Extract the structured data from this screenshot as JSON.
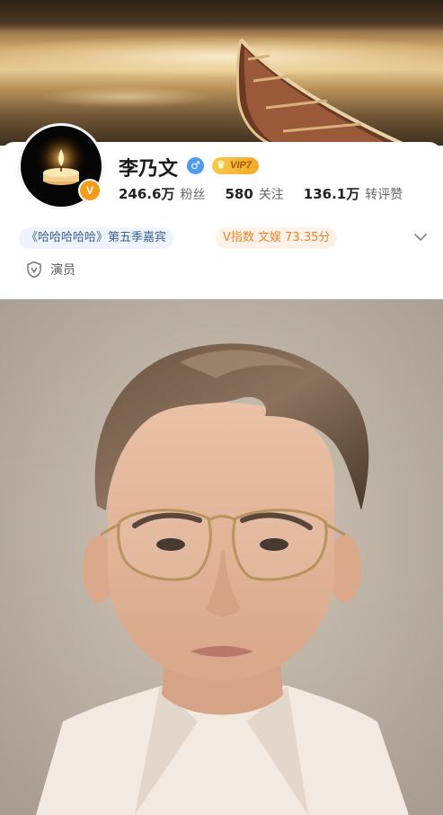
{
  "profile": {
    "name": "李乃文",
    "gender_icon": "male-icon",
    "vip_label": "VIP7",
    "avatar_badge": "V",
    "colors": {
      "accent_orange": "#f49b18",
      "verified_blue": "#4c9bf0"
    }
  },
  "stats": [
    {
      "value": "246.6万",
      "label": "粉丝"
    },
    {
      "value": "580",
      "label": "关注"
    },
    {
      "value": "136.1万",
      "label": "转评赞"
    }
  ],
  "tags": {
    "show_guest": "《哈哈哈哈哈》第五季嘉宾",
    "v_index": "V指数 文娱 73.35分"
  },
  "role": {
    "icon": "shield-v-icon",
    "label": "演员"
  }
}
